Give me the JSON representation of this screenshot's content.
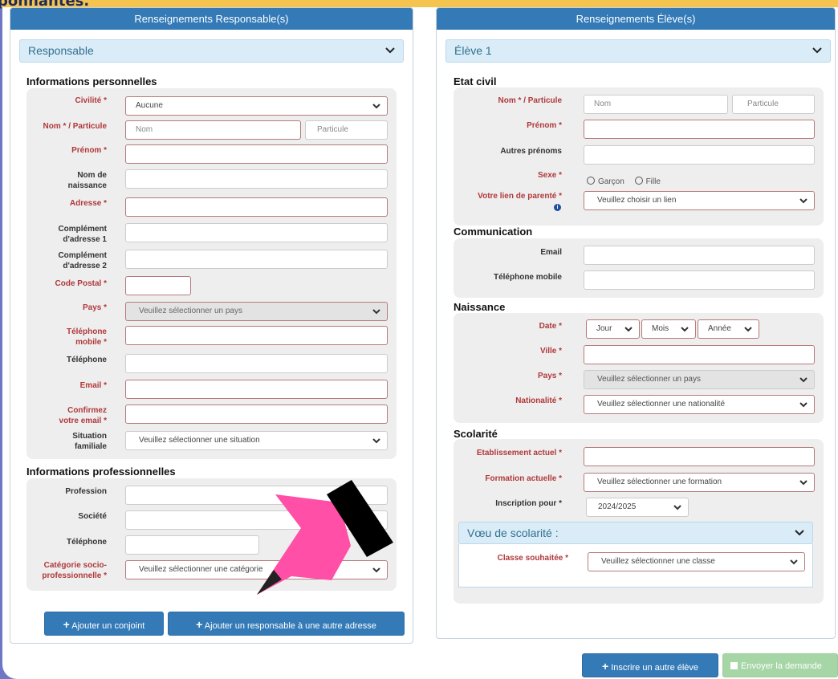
{
  "header": {
    "banner_text": "ponnantes."
  },
  "responsable": {
    "panel_title": "Renseignements Responsable(s)",
    "accordion": "Responsable",
    "section_perso": "Informations personnelles",
    "fields": {
      "civilite": {
        "label": "Civilité *",
        "value": "Aucune"
      },
      "nom": {
        "label": "Nom * / Particule",
        "placeholder": "Nom",
        "particule_placeholder": "Particule"
      },
      "prenom": {
        "label": "Prénom *"
      },
      "nom_naissance": {
        "label": "Nom de naissance"
      },
      "adresse": {
        "label": "Adresse *"
      },
      "complement1": {
        "label": "Complément d'adresse 1"
      },
      "complement2": {
        "label": "Complément d'adresse 2"
      },
      "code_postal": {
        "label": "Code Postal *"
      },
      "pays": {
        "label": "Pays *",
        "value": "Veuillez sélectionner un pays"
      },
      "tel_mobile": {
        "label": "Téléphone mobile *"
      },
      "telephone": {
        "label": "Téléphone"
      },
      "email": {
        "label": "Email *"
      },
      "confirm_email": {
        "label": "Confirmez votre email *"
      },
      "situation": {
        "label": "Situation familiale",
        "value": "Veuillez sélectionner une situation"
      }
    },
    "section_pro": "Informations professionnelles",
    "pro_fields": {
      "profession": {
        "label": "Profession"
      },
      "societe": {
        "label": "Société"
      },
      "telephone": {
        "label": "Téléphone"
      },
      "categorie": {
        "label": "Catégorie socio-professionnelle *",
        "value": "Veuillez sélectionner une catégorie"
      }
    },
    "buttons": {
      "add_conjoint": "Ajouter un conjoint",
      "add_responsable": "Ajouter un responsable à une autre adresse"
    }
  },
  "eleve": {
    "panel_title": "Renseignements Élève(s)",
    "accordion": "Élève 1",
    "section_civil": "Etat civil",
    "fields": {
      "nom": {
        "label": "Nom * / Particule",
        "placeholder": "Nom",
        "particule_placeholder": "Particule"
      },
      "prenom": {
        "label": "Prénom *"
      },
      "autres_prenoms": {
        "label": "Autres prénoms"
      },
      "sexe": {
        "label": "Sexe *",
        "option1": "Garçon",
        "option2": "Fille"
      },
      "lien": {
        "label": "Votre lien de parenté *",
        "value": "Veuillez choisir un lien",
        "info": "i"
      }
    },
    "section_comm": "Communication",
    "comm": {
      "email": "Email",
      "tel_mobile": "Téléphone mobile"
    },
    "section_naissance": "Naissance",
    "naissance": {
      "date_label": "Date *",
      "jour": "Jour",
      "mois": "Mois",
      "annee": "Année",
      "ville_label": "Ville *",
      "pays_label": "Pays *",
      "pays_value": "Veuillez sélectionner un pays",
      "nationalite_label": "Nationalité *",
      "nationalite_value": "Veuillez sélectionner une nationalité"
    },
    "section_scolarite": "Scolarité",
    "scolarite": {
      "etab_label": "Etablissement actuel *",
      "formation_label": "Formation actuelle *",
      "formation_value": "Veuillez sélectionner une formation",
      "inscription_label": "Inscription pour *",
      "inscription_value": "2024/2025",
      "voeu_title": "Vœu de scolarité :",
      "classe_label": "Classe souhaitée *",
      "classe_value": "Veuillez sélectionner une classe"
    }
  },
  "footer": {
    "inscrire": "Inscrire un autre élève",
    "envoyer": "Envoyer la demande"
  },
  "colors": {
    "primary": "#337ab7",
    "required": "#b0383a",
    "accordion": "#d9ecf8",
    "pointer": "#ff4fa7"
  }
}
